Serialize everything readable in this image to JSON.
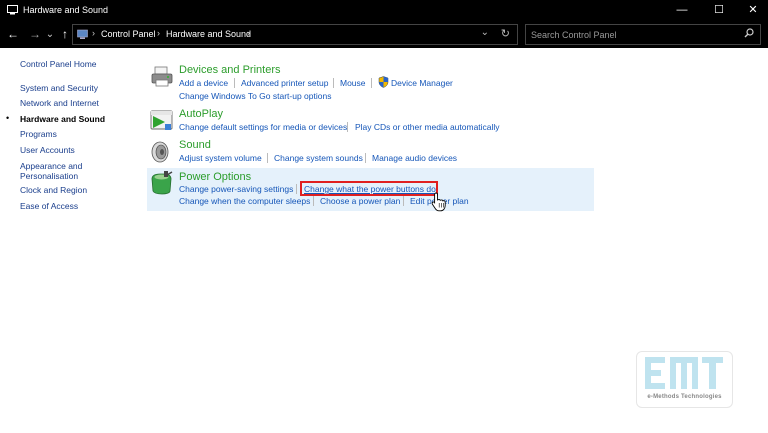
{
  "window": {
    "title": "Hardware and Sound",
    "minimize": "—",
    "maximize": "☐",
    "close": "✕"
  },
  "nav": {
    "back": "←",
    "forward": "→",
    "recent": "⌄",
    "up": "↑",
    "breadcrumbs": [
      "Control Panel",
      "Hardware and Sound"
    ],
    "search_placeholder": "Search Control Panel"
  },
  "sidebar": {
    "items": [
      {
        "label": "Control Panel Home"
      },
      {
        "label": "System and Security"
      },
      {
        "label": "Network and Internet"
      },
      {
        "label": "Hardware and Sound",
        "current": true
      },
      {
        "label": "Programs"
      },
      {
        "label": "User Accounts"
      },
      {
        "label": "Appearance and Personalisation"
      },
      {
        "label": "Clock and Region"
      },
      {
        "label": "Ease of Access"
      }
    ]
  },
  "categories": {
    "devices": {
      "title": "Devices and Printers",
      "icon": "printer-icon",
      "links": [
        "Add a device",
        "Advanced printer setup",
        "Mouse",
        "Device Manager",
        "Change Windows To Go start-up options"
      ]
    },
    "autoplay": {
      "title": "AutoPlay",
      "icon": "autoplay-icon",
      "links": [
        "Change default settings for media or devices",
        "Play CDs or other media automatically"
      ]
    },
    "sound": {
      "title": "Sound",
      "icon": "speaker-icon",
      "links": [
        "Adjust system volume",
        "Change system sounds",
        "Manage audio devices"
      ]
    },
    "power": {
      "title": "Power Options",
      "icon": "power-options-icon",
      "links": [
        "Change power-saving settings",
        "Change what the power buttons do",
        "Change when the computer sleeps",
        "Choose a power plan",
        "Edit power plan"
      ]
    }
  },
  "watermark": {
    "tagline": "e-Methods Technologies"
  },
  "colors": {
    "chrome": "#000000",
    "category_title": "#2c9d2c",
    "link": "#1556b8",
    "hover_bg": "#e5f1fb",
    "annotation": "#e02020"
  }
}
